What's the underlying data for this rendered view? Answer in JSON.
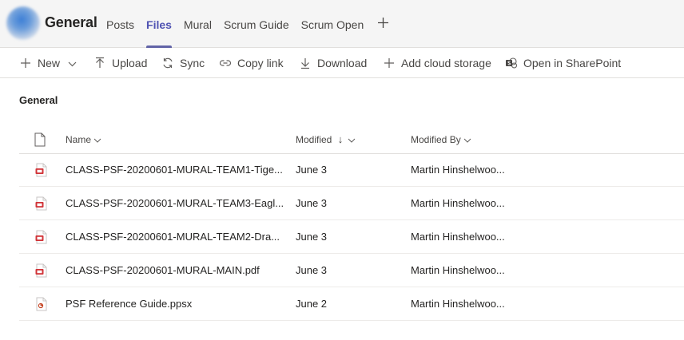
{
  "header": {
    "channel_name": "General",
    "tabs": [
      {
        "label": "Posts",
        "active": false
      },
      {
        "label": "Files",
        "active": true
      },
      {
        "label": "Mural",
        "active": false
      },
      {
        "label": "Scrum Guide",
        "active": false
      },
      {
        "label": "Scrum Open",
        "active": false
      }
    ],
    "add_tab_icon": "plus-icon"
  },
  "toolbar": {
    "new_label": "New",
    "upload_label": "Upload",
    "sync_label": "Sync",
    "copy_link_label": "Copy link",
    "download_label": "Download",
    "add_cloud_label": "Add cloud storage",
    "sharepoint_label": "Open in SharePoint"
  },
  "section": {
    "title": "General"
  },
  "table": {
    "columns": {
      "name": "Name",
      "modified": "Modified",
      "modified_sort_arrow": "↓",
      "modified_by": "Modified By"
    },
    "rows": [
      {
        "name": "CLASS-PSF-20200601-MURAL-TEAM1-Tige...",
        "modified": "June 3",
        "modified_by": "Martin Hinshelwoo...",
        "type": "pdf"
      },
      {
        "name": "CLASS-PSF-20200601-MURAL-TEAM3-Eagl...",
        "modified": "June 3",
        "modified_by": "Martin Hinshelwoo...",
        "type": "pdf"
      },
      {
        "name": "CLASS-PSF-20200601-MURAL-TEAM2-Dra...",
        "modified": "June 3",
        "modified_by": "Martin Hinshelwoo...",
        "type": "pdf"
      },
      {
        "name": "CLASS-PSF-20200601-MURAL-MAIN.pdf",
        "modified": "June 3",
        "modified_by": "Martin Hinshelwoo...",
        "type": "pdf"
      },
      {
        "name": "PSF Reference Guide.ppsx",
        "modified": "June 2",
        "modified_by": "Martin Hinshelwoo...",
        "type": "ppsx"
      }
    ]
  },
  "colors": {
    "accent": "#6264a7",
    "pdf_red": "#d13438"
  }
}
